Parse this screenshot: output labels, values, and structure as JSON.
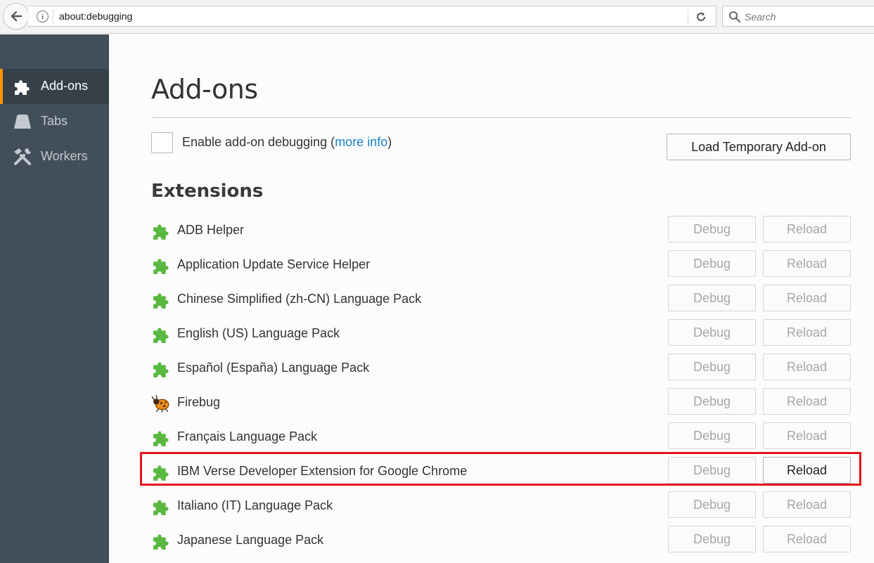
{
  "browser": {
    "url": "about:debugging",
    "search_placeholder": "Search",
    "icons": {
      "back": "back-arrow-icon",
      "info": "info-icon",
      "reload": "reload-icon",
      "search": "search-icon"
    }
  },
  "sidebar": {
    "items": [
      {
        "label": "Add-ons",
        "icon": "puzzle-icon",
        "active": true
      },
      {
        "label": "Tabs",
        "icon": "tab-icon",
        "active": false
      },
      {
        "label": "Workers",
        "icon": "hammer-wrench-icon",
        "active": false
      }
    ],
    "active_indicator_color": "#ff9400"
  },
  "main": {
    "title": "Add-ons",
    "enable_label": "Enable add-on debugging (",
    "enable_link": "more info",
    "enable_suffix": ")",
    "load_button": "Load Temporary Add-on",
    "section_title": "Extensions",
    "extensions": [
      {
        "name": "ADB Helper",
        "icon": "puzzle-icon",
        "debug": "Debug",
        "reload": "Reload",
        "reload_enabled": false
      },
      {
        "name": "Application Update Service Helper",
        "icon": "puzzle-icon",
        "debug": "Debug",
        "reload": "Reload",
        "reload_enabled": false
      },
      {
        "name": "Chinese Simplified (zh-CN) Language Pack",
        "icon": "puzzle-icon",
        "debug": "Debug",
        "reload": "Reload",
        "reload_enabled": false
      },
      {
        "name": "English (US) Language Pack",
        "icon": "puzzle-icon",
        "debug": "Debug",
        "reload": "Reload",
        "reload_enabled": false
      },
      {
        "name": "Español (España) Language Pack",
        "icon": "puzzle-icon",
        "debug": "Debug",
        "reload": "Reload",
        "reload_enabled": false
      },
      {
        "name": "Firebug",
        "icon": "firebug-icon",
        "debug": "Debug",
        "reload": "Reload",
        "reload_enabled": false
      },
      {
        "name": "Français Language Pack",
        "icon": "puzzle-icon",
        "debug": "Debug",
        "reload": "Reload",
        "reload_enabled": false
      },
      {
        "name": "IBM Verse Developer Extension for Google Chrome",
        "icon": "puzzle-icon",
        "debug": "Debug",
        "reload": "Reload",
        "reload_enabled": true,
        "highlighted": true
      },
      {
        "name": "Italiano (IT) Language Pack",
        "icon": "puzzle-icon",
        "debug": "Debug",
        "reload": "Reload",
        "reload_enabled": false
      },
      {
        "name": "Japanese Language Pack",
        "icon": "puzzle-icon",
        "debug": "Debug",
        "reload": "Reload",
        "reload_enabled": false
      }
    ],
    "highlight_color": "#e3141e",
    "link_color": "#1780c9",
    "puzzle_color": "#59b840"
  }
}
